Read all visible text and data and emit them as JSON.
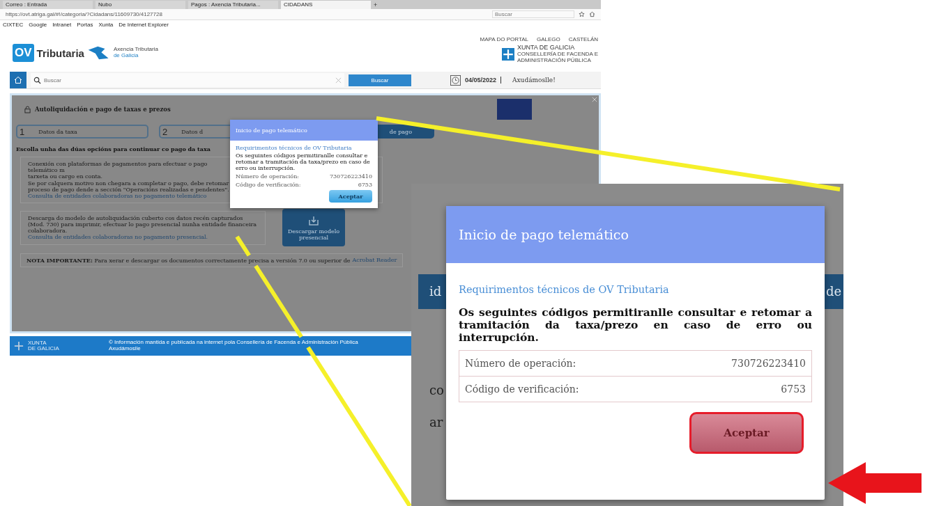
{
  "browser": {
    "tabs": [
      {
        "label": "Correo : Entrada",
        "selected": false
      },
      {
        "label": "Nubo",
        "selected": false
      },
      {
        "label": "Pagos : Axencia Tributaria...",
        "selected": false
      },
      {
        "label": "CIDADANS",
        "selected": true
      }
    ],
    "new_tab": "+",
    "url": "https://ovt.atriga.gal/#!/categoria/?Cidadans/11609730/4127728",
    "search_placeholder": "Buscar",
    "bookmarks": [
      "CIXTEC",
      "Google",
      "Intranet",
      "Portas",
      "Xunta",
      "De Internet Explorer"
    ]
  },
  "header": {
    "logo_badge": "OV",
    "logo_text": "Tributaria",
    "agency_line1": "Axencia Tributaria",
    "agency_line2": "de Galicia",
    "top_links": [
      "MAPA DO PORTAL",
      "GALEGO",
      "CASTELÁN"
    ],
    "xunta_title": "XUNTA DE GALICIA",
    "xunta_line1": "CONSELLERÍA DE FACENDA E",
    "xunta_line2": "ADMINISTRACIÓN PÚBLICA"
  },
  "navbar": {
    "search_placeholder": "Buscar",
    "search_button": "Buscar",
    "date": "04/05/2022",
    "help": "Axudámoslle!"
  },
  "content": {
    "title": "Autoliquidación e pago de taxas e prezos",
    "steps": [
      {
        "number": "1",
        "label": "Datos da taxa",
        "selected": false
      },
      {
        "number": "2",
        "label": "Datos d",
        "selected": false
      },
      {
        "label": "de pago",
        "selected": true
      }
    ],
    "prompt": "Escolla unha das dúas opcións para continuar co pago da taxa",
    "online_option": {
      "lines": [
        "Conexión con plataformas de pagamentos para efectuar o pago telemático m",
        "tarxeta ou cargo en conta.",
        "Se por calquera motivo non chegara a completar o pago, debe retomar",
        "proceso de pago dende a sección \"Operacións realizadas e pendentes\"."
      ],
      "link": "Consulta de entidades colaboradoras no pagamento telemático"
    },
    "presential_option": {
      "lines": [
        "Descarga do modelo de autoliquidación cuberto cos datos recén capturados",
        "(Mod. 730) para imprimir, efectuar lo pago presencial nunha entidade financeira",
        "colaboradora."
      ],
      "link": "Consulta de entidades colaboradoras no pagamento presencial.",
      "button": "Descargar modelo presencial"
    },
    "note": "**NOTA IMPORTANTE:** Para xerar e descargar os documentos correctamente precisa a versión 7.0 ou superior de",
    "note_link": "Acrobat Reader"
  },
  "footer": {
    "logo_line1": "XUNTA",
    "logo_line2": "DE GALICIA",
    "text": "© Información mantida e publicada na internet pola Consellería de Facenda e Administración Pública",
    "link": "Axudámoslle"
  },
  "modal": {
    "title": "Inicio de pago telemático",
    "subtitle": "Requirimentos técnicos de OV Tributaria",
    "text": "Os seguintes códigos permitiranlle consultar e retomar a tramitación da taxa/prezo en caso de erro ou interrupción.",
    "rows": [
      {
        "label": "Número de operación:",
        "value": "730726223410"
      },
      {
        "label": "Código de verificación:",
        "value": "6753"
      }
    ],
    "button": "Aceptar"
  },
  "zoom": {
    "fragments": [
      "id",
      "de",
      "co",
      "ar"
    ],
    "modal": {
      "title": "Inicio de pago telemático",
      "subtitle": "Requirimentos técnicos de OV Tributaria",
      "text": "Os seguintes códigos permitiranlle consultar e retomar a tramitación da taxa/prezo en caso de erro ou interrupción.",
      "rows": [
        {
          "label": "Número de operación:",
          "value": "730726223410"
        },
        {
          "label": "Código de verificación:",
          "value": "6753"
        }
      ],
      "button": "Aceptar",
      "button_highlighted": true
    }
  }
}
